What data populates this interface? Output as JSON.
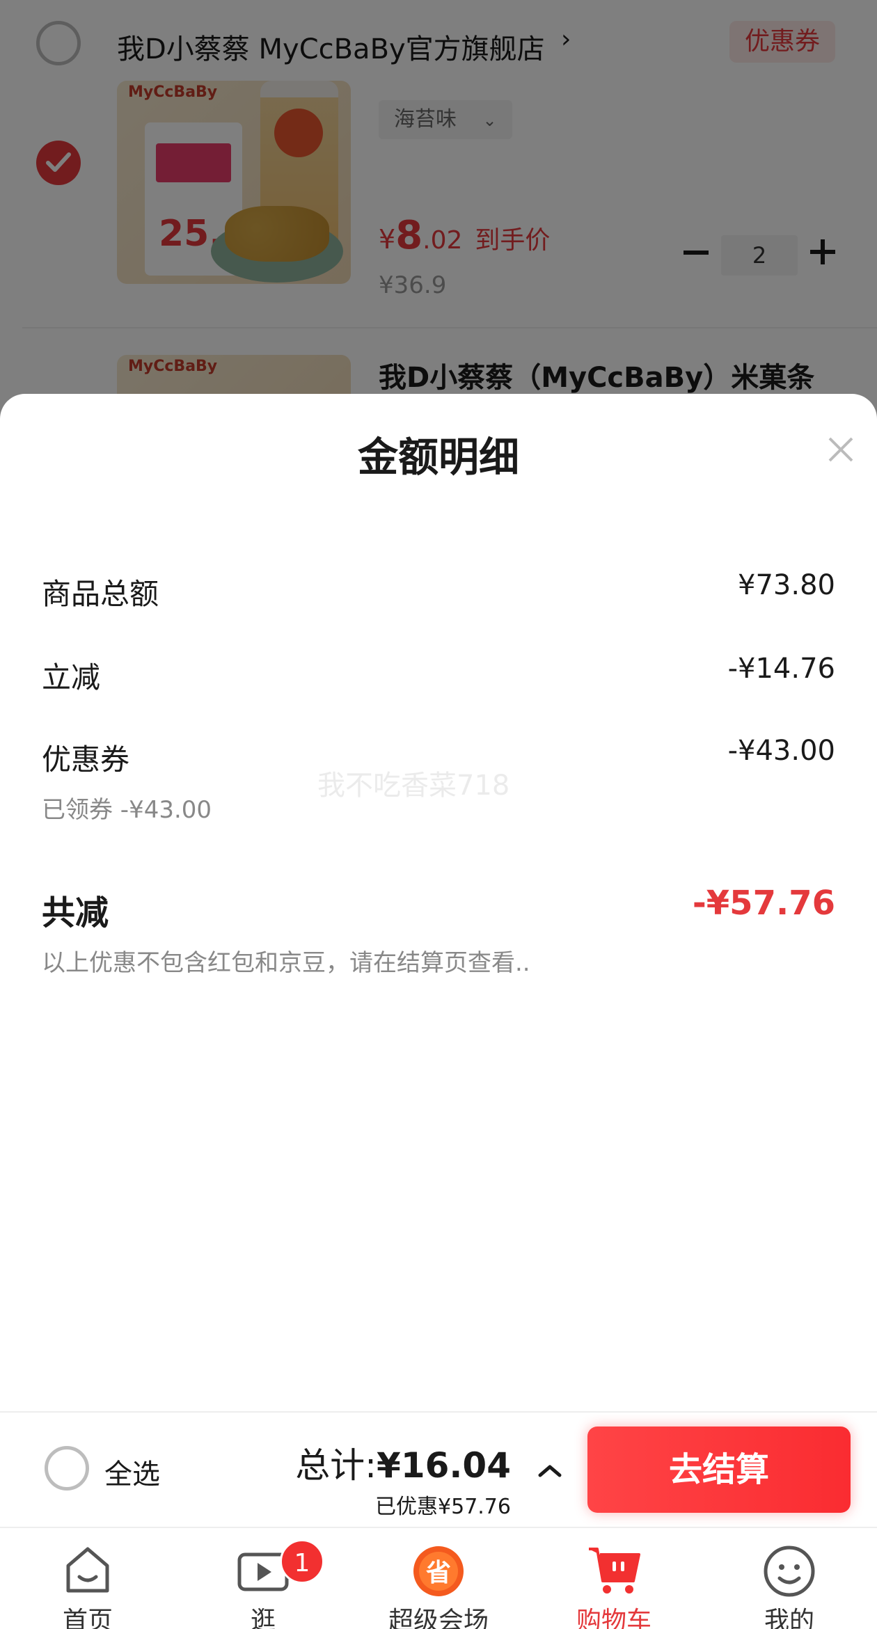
{
  "store": {
    "name": "我D小蔡蔡 MyCcBaBy官方旗舰店",
    "chevron": "›",
    "coupon_label": "优惠券"
  },
  "product1": {
    "logo": "MyCcBaBy",
    "variant": "海苔味",
    "price_symbol": "¥",
    "price_int": "8",
    "price_dec": ".02",
    "price_tag": "到手价",
    "original_price": "¥36.9",
    "quantity": "2"
  },
  "product2": {
    "title": "我D小蔡蔡（MyCcBaBy）米菓条"
  },
  "sheet": {
    "title": "金额明细",
    "rows": [
      {
        "label": "商品总额",
        "value": "¥73.80"
      },
      {
        "label": "立减",
        "value": "-¥14.76"
      },
      {
        "label": "优惠券",
        "value": "-¥43.00",
        "sub": "已领券 -¥43.00"
      }
    ],
    "total_label": "共减",
    "total_value": "-¥57.76",
    "note": "以上优惠不包含红包和京豆，请在结算页查看..",
    "watermark": "我不吃香菜718"
  },
  "checkout": {
    "select_all": "全选",
    "total_prefix": "总计:",
    "total_amount": "¥16.04",
    "saved": "已优惠¥57.76",
    "button": "去结算"
  },
  "tabs": [
    {
      "label": "首页",
      "icon": "home-icon"
    },
    {
      "label": "逛",
      "icon": "video-icon",
      "badge": "1"
    },
    {
      "label": "超级会场",
      "icon": "super-venue-icon"
    },
    {
      "label": "购物车",
      "icon": "cart-icon",
      "active": true
    },
    {
      "label": "我的",
      "icon": "profile-icon"
    }
  ],
  "colors": {
    "accent": "#e4393c",
    "checkout_button": "#fa2c31"
  }
}
